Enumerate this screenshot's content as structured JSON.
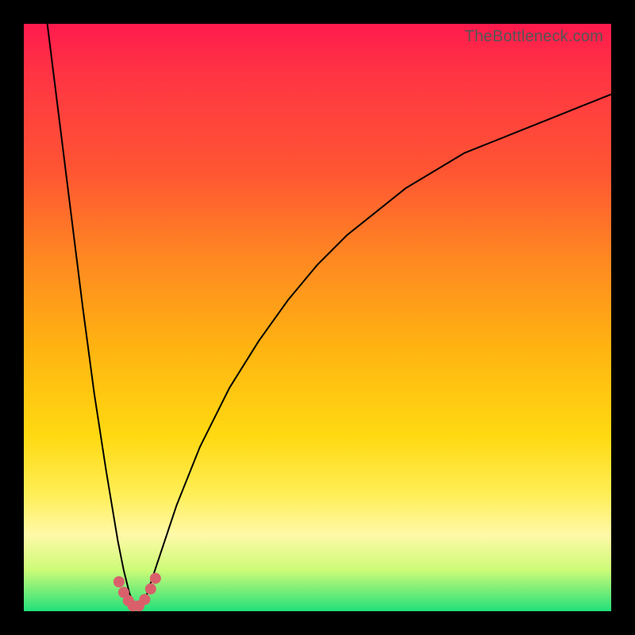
{
  "attribution": "TheBottleneck.com",
  "colors": {
    "frame": "#000000",
    "curve_stroke": "#000000",
    "marker_fill": "#d9606b",
    "gradient_top": "#ff1a4d",
    "gradient_bottom": "#22e07a"
  },
  "chart_data": {
    "type": "line",
    "title": "",
    "xlabel": "",
    "ylabel": "",
    "xlim": [
      0,
      100
    ],
    "ylim": [
      0,
      100
    ],
    "comment": "Bottleneck-shaped curve; y is bottleneck %, minimum ≈0 at x≈19. Left branch falls steeply from ~100 at x≈4; right branch rises toward ~88 at x=100.",
    "series": [
      {
        "name": "curve",
        "x": [
          4,
          6,
          8,
          10,
          12,
          14,
          16,
          17,
          18,
          19,
          20,
          21,
          22,
          24,
          26,
          30,
          35,
          40,
          45,
          50,
          55,
          60,
          65,
          70,
          75,
          80,
          85,
          90,
          95,
          100
        ],
        "y": [
          100,
          84,
          68,
          52,
          37,
          24,
          12,
          7,
          3,
          0.5,
          1,
          3,
          6,
          12,
          18,
          28,
          38,
          46,
          53,
          59,
          64,
          68,
          72,
          75,
          78,
          80,
          82,
          84,
          86,
          88
        ]
      }
    ],
    "markers": {
      "comment": "Red dots clustered near minimum",
      "x": [
        16.2,
        17.0,
        17.8,
        18.6,
        19.6,
        20.6,
        21.6,
        22.4
      ],
      "y": [
        5.0,
        3.2,
        1.8,
        0.9,
        0.9,
        2.0,
        3.8,
        5.6
      ]
    }
  }
}
